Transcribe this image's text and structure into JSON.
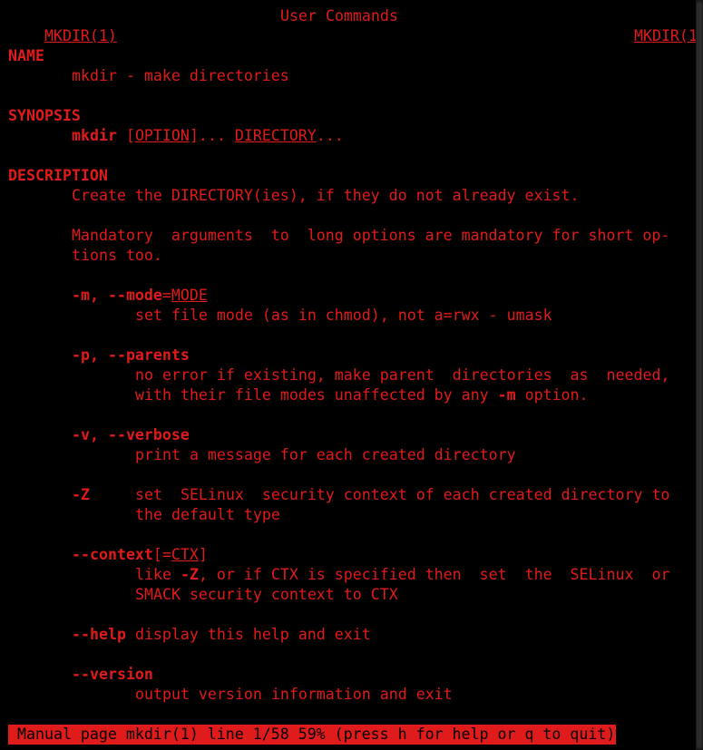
{
  "header": {
    "left_title": "MKDIR(1)",
    "center_title": "User Commands",
    "right_title": "MKDIR(1)"
  },
  "sections": {
    "name_heading": "NAME",
    "name_text": "mkdir - make directories",
    "synopsis_heading": "SYNOPSIS",
    "synopsis_cmd": "mkdir",
    "synopsis_option": "OPTION",
    "synopsis_dir": "DIRECTORY",
    "description_heading": "DESCRIPTION",
    "description_line1": "Create the DIRECTORY(ies), if they do not already exist.",
    "description_line2": "Mandatory  arguments  to  long options are mandatory for short op-",
    "description_line3": "tions too."
  },
  "options": {
    "mode_flags": "-m, --mode",
    "mode_arg": "MODE",
    "mode_desc": "set file mode (as in chmod), not a=rwx - umask",
    "parents_flags": "-p, --parents",
    "parents_desc1": "no error if existing, make parent  directories  as  needed,",
    "parents_desc2a": "with their file modes unaffected by any ",
    "parents_desc2b": "-m",
    "parents_desc2c": " option.",
    "verbose_flags": "-v, --verbose",
    "verbose_desc": "print a message for each created directory",
    "z_flag": "-Z",
    "z_desc1": "set  SELinux  security context of each created directory to",
    "z_desc2": "the default type",
    "context_flag": "--context",
    "context_arg": "CTX",
    "context_desc1a": "like ",
    "context_desc1b": "-Z",
    "context_desc1c": ", or if CTX is specified then  set  the  SELinux  or",
    "context_desc2": "SMACK security context to CTX",
    "help_flag": "--help",
    "help_desc": "display this help and exit",
    "version_flag": "--version",
    "version_desc": "output version information and exit"
  },
  "status_bar": {
    "text": "Manual page mkdir(1) line 1/58 59% (press h for help or q to quit)"
  },
  "colors": {
    "background": "#000000",
    "foreground": "#e01b1b"
  }
}
